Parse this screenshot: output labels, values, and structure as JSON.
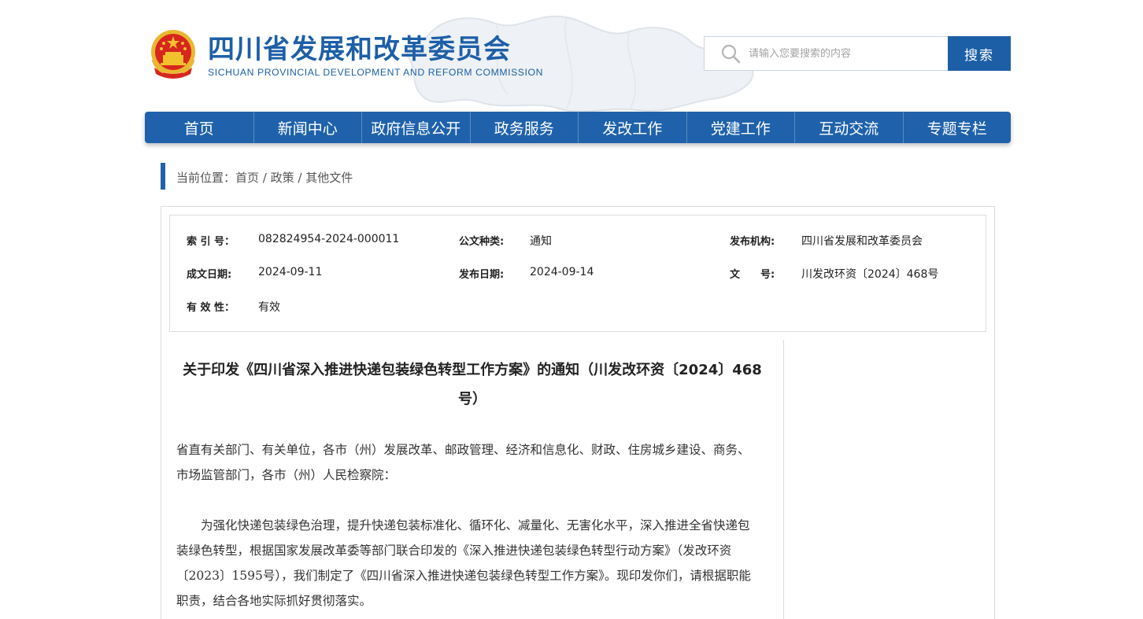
{
  "header": {
    "title_cn": "四川省发展和改革委员会",
    "title_en": "SICHUAN  PROVINCIAL  DEVELOPMENT  AND  REFORM  COMMISSION"
  },
  "search": {
    "placeholder": "请输入您要搜索的内容",
    "button_label": "搜索"
  },
  "nav": {
    "items": [
      "首页",
      "新闻中心",
      "政府信息公开",
      "政务服务",
      "发改工作",
      "党建工作",
      "互动交流",
      "专题专栏"
    ]
  },
  "breadcrumb": {
    "prefix": "当前位置：",
    "items": [
      "首页",
      "政策",
      "其他文件"
    ],
    "separator": " / "
  },
  "info": {
    "index_label": "索 引 号：",
    "index_value": "082824954-2024-000011",
    "type_label": "公文种类:",
    "type_value": "通知",
    "org_label": "发布机构:",
    "org_value": "四川省发展和改革委员会",
    "created_label": "成文日期:",
    "created_value": "2024-09-11",
    "published_label": "发布日期:",
    "published_value": "2024-09-14",
    "docno_label": "文　　号:",
    "docno_value": "川发改环资〔2024〕468号",
    "validity_label": "有 效 性：",
    "validity_value": "有效"
  },
  "article": {
    "title": "关于印发《四川省深入推进快递包装绿色转型工作方案》的通知（川发改环资〔2024〕468号）",
    "p1": "省直有关部门、有关单位，各市（州）发展改革、邮政管理、经济和信息化、财政、住房城乡建设、商务、市场监管部门，各市（州）人民检察院：",
    "p2": "为强化快递包装绿色治理，提升快递包装标准化、循环化、减量化、无害化水平，深入推进全省快递包装绿色转型，根据国家发展改革委等部门联合印发的《深入推进快递包装绿色转型行动方案》（发改环资〔2023〕1595号），我们制定了《四川省深入推进快递包装绿色转型工作方案》。现印发你们，请根据职能职责，结合各地实际抓好贯彻落实。"
  },
  "colors": {
    "brand_blue": "#1d5fa7",
    "emblem_red": "#d7261e",
    "emblem_gold": "#f2c12e"
  }
}
